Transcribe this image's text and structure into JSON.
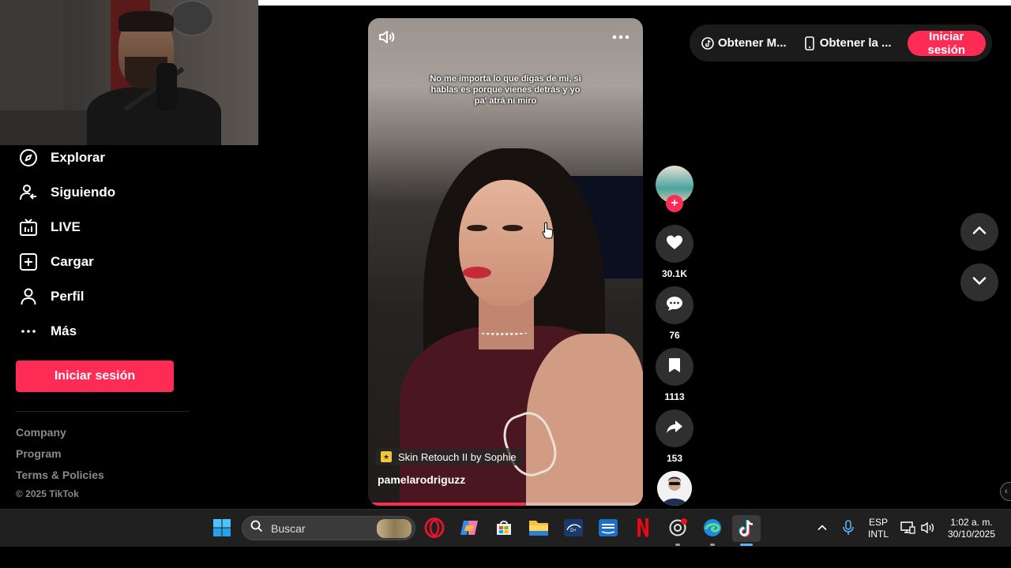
{
  "sidebar": {
    "items": [
      {
        "label": "Explorar",
        "icon": "compass-icon"
      },
      {
        "label": "Siguiendo",
        "icon": "following-icon"
      },
      {
        "label": "LIVE",
        "icon": "live-tv-icon"
      },
      {
        "label": "Cargar",
        "icon": "upload-icon"
      },
      {
        "label": "Perfil",
        "icon": "profile-icon"
      },
      {
        "label": "Más",
        "icon": "more-dots-icon"
      }
    ],
    "login_label": "Iniciar sesión",
    "footer_links": [
      "Company",
      "Program",
      "Terms & Policies"
    ],
    "copyright": "© 2025 TikTok"
  },
  "topbar": {
    "link1": "Obtener M...",
    "link2": "Obtener la ...",
    "login_label": "Iniciar sesión"
  },
  "video": {
    "caption_lines": [
      "No me importa lo que digas de mi, si",
      "hablas es porque vienes detrás y yo",
      "pa' atrá ni miro"
    ],
    "effect_label": "Skin Retouch II by Sophie",
    "author": "pamelarodriguzz",
    "progress": 0.57
  },
  "actions": {
    "likes": "30.1K",
    "comments": "76",
    "saves": "1113",
    "shares": "153"
  },
  "taskbar": {
    "search_placeholder": "Buscar",
    "lang_top": "ESP",
    "lang_bottom": "INTL",
    "time": "1:02 a. m.",
    "date": "30/10/2025"
  },
  "colors": {
    "accent": "#fe2c55",
    "background": "#000000",
    "rail_button": "#2f2f2f"
  }
}
